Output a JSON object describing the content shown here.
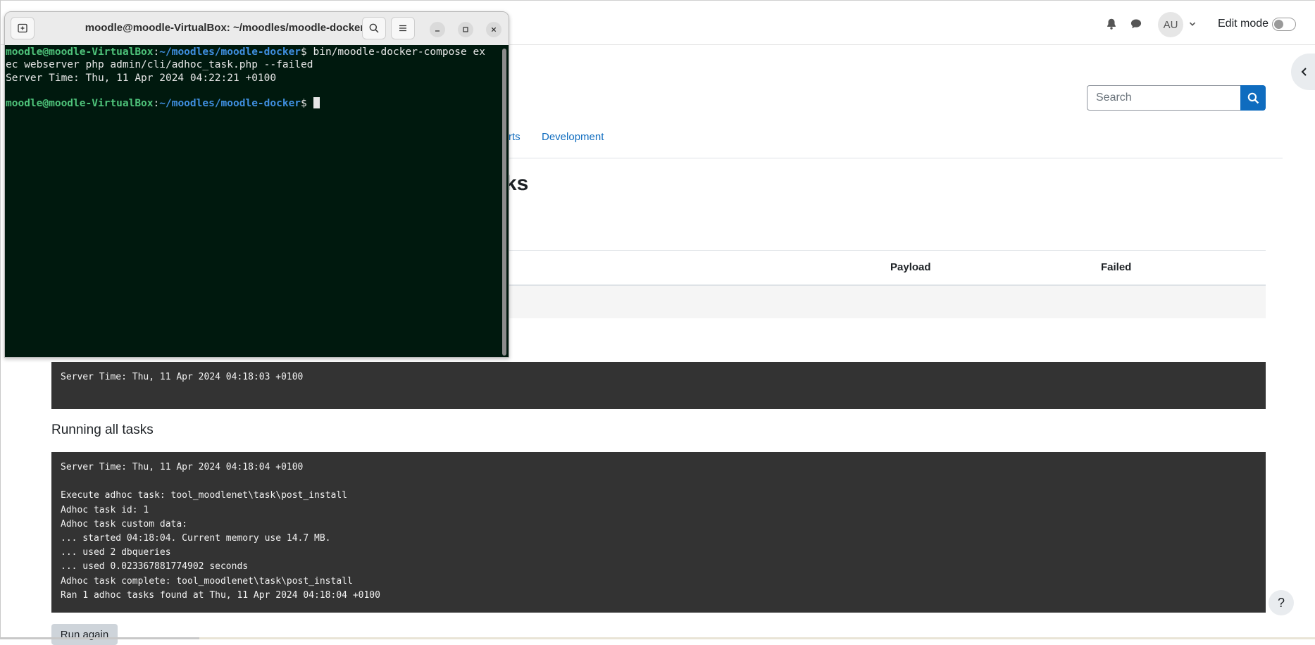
{
  "navbar": {
    "avatar_initials": "AU",
    "edit_mode_label": "Edit mode"
  },
  "search": {
    "placeholder": "Search"
  },
  "tabs": {
    "partial_label": "rts",
    "development_label": "Development"
  },
  "page": {
    "heading_partial": "ks"
  },
  "table": {
    "headers": [
      "Payload",
      "Failed"
    ]
  },
  "outputs": {
    "first_block": "Server Time: Thu, 11 Apr 2024 04:18:03 +0100",
    "section_title": "Running all tasks",
    "second_block": "Server Time: Thu, 11 Apr 2024 04:18:04 +0100\n\nExecute adhoc task: tool_moodlenet\\task\\post_install\nAdhoc task id: 1\nAdhoc task custom data:\n... started 04:18:04. Current memory use 14.7 MB.\n... used 2 dbqueries\n... used 0.023367881774902 seconds\nAdhoc task complete: tool_moodlenet\\task\\post_install\nRan 1 adhoc tasks found at Thu, 11 Apr 2024 04:18:04 +0100"
  },
  "buttons": {
    "run_again": "Run again",
    "help": "?"
  },
  "terminal": {
    "title": "moodle@moodle-VirtualBox: ~/moodles/moodle-docker",
    "prompt_user": "moodle@moodle-VirtualBox",
    "prompt_sep": ":",
    "prompt_path": "~/moodles/moodle-docker",
    "prompt_end": "$ ",
    "command_line1": "bin/moodle-docker-compose ex",
    "command_line2": "ec webserver php admin/cli/adhoc_task.php --failed",
    "output_line": "Server Time: Thu, 11 Apr 2024 04:22:21 +0100"
  },
  "icons": {
    "notifications": "bell-icon",
    "messages": "chat-icon",
    "search": "search-icon",
    "drawer": "chevron-left-icon",
    "new_tab": "new-tab-icon",
    "menu": "hamburger-icon",
    "minimize": "minimize-icon",
    "maximize": "maximize-icon",
    "close": "close-icon"
  },
  "colors": {
    "moodle_blue": "#0f6cbf",
    "terminal_bg": "#00190e",
    "prompt_user": "#4ec37a",
    "prompt_path": "#3f8fe0",
    "pre_bg": "#333333"
  }
}
